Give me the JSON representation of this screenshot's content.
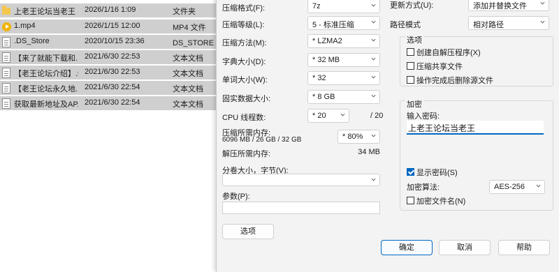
{
  "files": [
    {
      "icon": "folder-icon",
      "name": "上老王论坛当老王",
      "date": "2026/1/16 1:09",
      "type": "文件夹"
    },
    {
      "icon": "video-icon",
      "name": "1.mp4",
      "date": "2026/1/15 12:00",
      "type": "MP4 文件"
    },
    {
      "icon": "file-icon",
      "name": ".DS_Store",
      "date": "2020/10/15 23:36",
      "type": "DS_STORE 文件"
    },
    {
      "icon": "text-file-icon",
      "name": "【来了就能下载和...",
      "date": "2021/6/30 22:53",
      "type": "文本文档"
    },
    {
      "icon": "text-file-icon",
      "name": "【老王论坛介绍】.txt",
      "date": "2021/6/30 22:53",
      "type": "文本文档"
    },
    {
      "icon": "text-file-icon",
      "name": "【老王论坛永久地...",
      "date": "2021/6/30 22:54",
      "type": "文本文档"
    },
    {
      "icon": "text-file-icon",
      "name": "获取最新地址及AP...",
      "date": "2021/6/30 22:54",
      "type": "文本文档"
    }
  ],
  "dialog": {
    "format_label": "压缩格式(F):",
    "format_value": "7z",
    "level_label": "压缩等级(L):",
    "level_value": "5 - 标准压缩",
    "method_label": "压缩方法(M):",
    "method_value": "* LZMA2",
    "dict_label": "字典大小(D):",
    "dict_value": "* 32 MB",
    "word_label": "单词大小(W):",
    "word_value": "* 32",
    "solid_label": "固实数据大小:",
    "solid_value": "* 8 GB",
    "threads_label": "CPU 线程数:",
    "threads_value": "* 20",
    "threads_max": "/ 20",
    "mem_label": "压缩所需内存:",
    "mem_detail": "6096 MB / 26 GB / 32 GB",
    "mem_percent": "* 80%",
    "decomp_label": "解压所需内存:",
    "decomp_value": "34 MB",
    "split_label": "分卷大小，字节(V):",
    "split_value": "",
    "params_label": "参数(P):",
    "params_value": "",
    "options_button": "选项",
    "update_label": "更新方式(U):",
    "update_value": "添加并替换文件",
    "path_label": "路径模式",
    "path_value": "相对路径",
    "options_group": "选项",
    "opt_sfx": "创建自解压程序(X)",
    "opt_shared": "压缩共享文件",
    "opt_delete": "操作完成后删除源文件",
    "encryption_group": "加密",
    "password_label": "输入密码:",
    "password_value": "上老王论坛当老王",
    "show_password": "显示密码(S)",
    "enc_method_label": "加密算法:",
    "enc_method_value": "AES-256",
    "encrypt_names": "加密文件名(N)",
    "ok": "确定",
    "cancel": "取消",
    "help": "帮助"
  }
}
